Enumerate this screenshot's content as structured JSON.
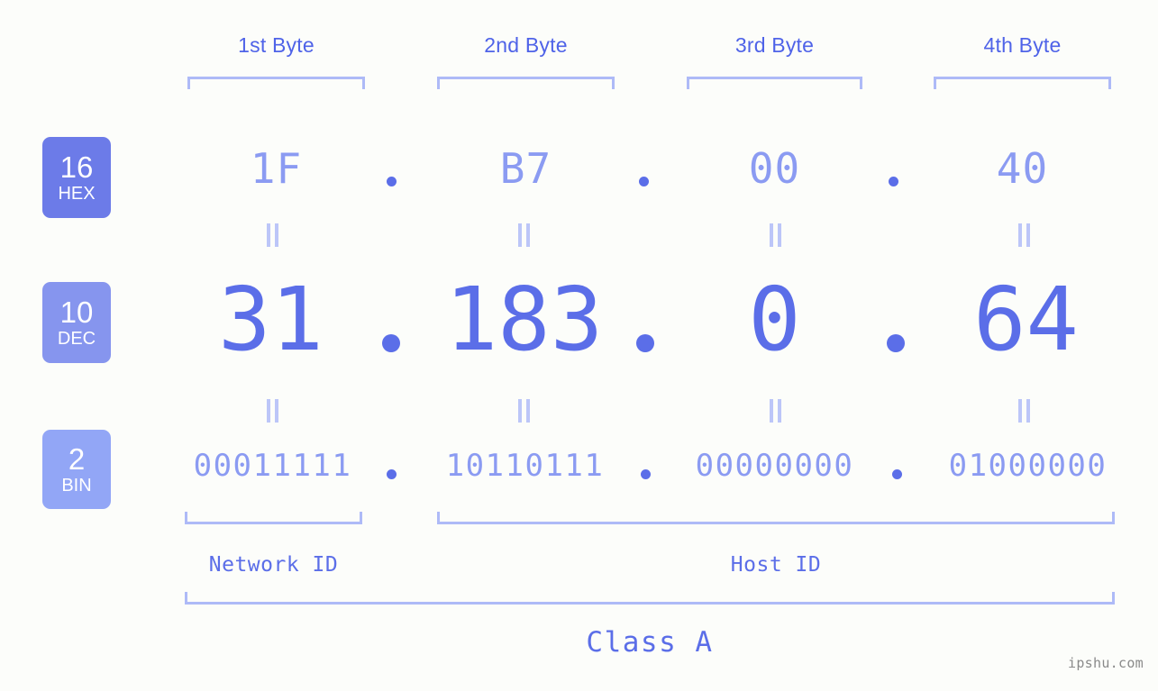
{
  "background_color": "#FCFDFA",
  "accent_colors": {
    "label_blue": "#4F63E8",
    "value_blue": "#5B6EE8",
    "light_periwinkle": "#8B9BF2",
    "bracket": "#AEBAF7",
    "badge_hex": "#6C7BE8",
    "badge_dec": "#8695EE",
    "badge_bin": "#92A6F6",
    "watermark_gray": "#8A8A8A"
  },
  "byte_headers": [
    {
      "label": "1st Byte"
    },
    {
      "label": "2nd Byte"
    },
    {
      "label": "3rd Byte"
    },
    {
      "label": "4th Byte"
    }
  ],
  "rows": [
    {
      "badge_number": "16",
      "badge_name": "HEX",
      "values": [
        "1F",
        "B7",
        "00",
        "40"
      ],
      "separator": "."
    },
    {
      "badge_number": "10",
      "badge_name": "DEC",
      "values": [
        "31",
        "183",
        "0",
        "64"
      ],
      "separator": "."
    },
    {
      "badge_number": "2",
      "badge_name": "BIN",
      "values": [
        "00011111",
        "10110111",
        "00000000",
        "01000000"
      ],
      "separator": "."
    }
  ],
  "equivalence_mark": "||",
  "segments": {
    "network_id_label": "Network ID",
    "host_id_label": "Host ID",
    "class_label": "Class A"
  },
  "watermark": "ipshu.com"
}
